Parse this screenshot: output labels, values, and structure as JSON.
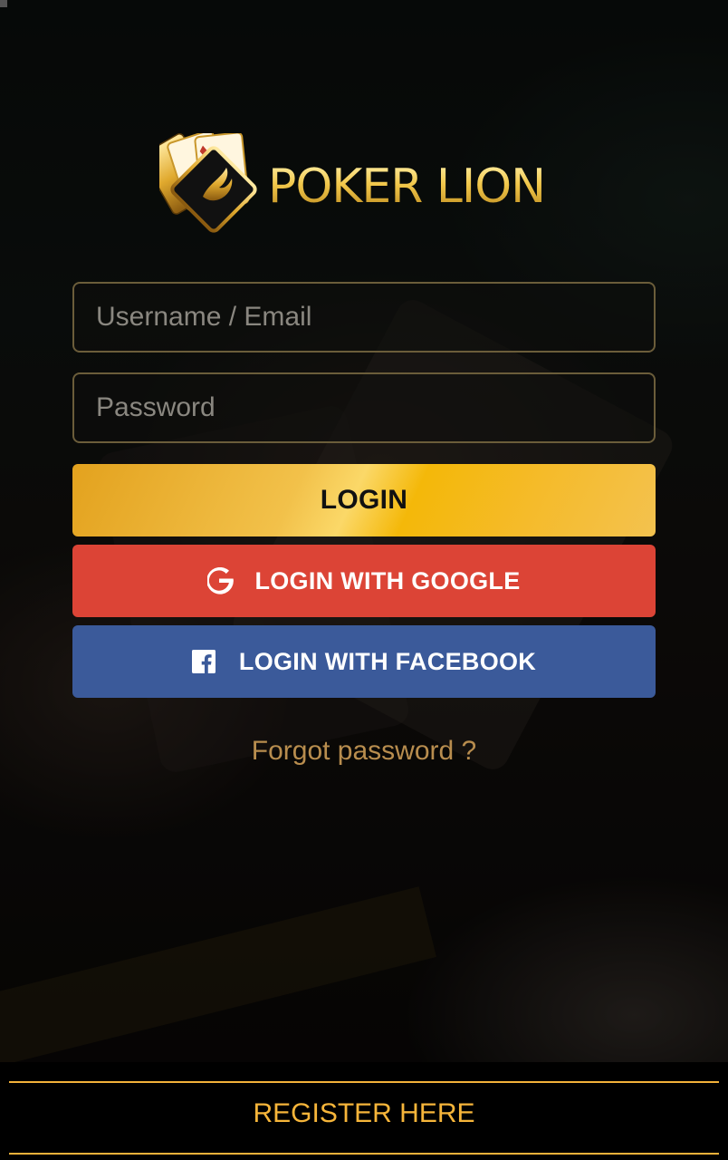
{
  "brand": {
    "name": "POKER LION",
    "accent_gold": "#f3b23a"
  },
  "login_form": {
    "username_placeholder": "Username / Email",
    "password_placeholder": "Password",
    "login_label": "LOGIN",
    "google_label": "LOGIN WITH GOOGLE",
    "facebook_label": "LOGIN WITH FACEBOOK",
    "forgot_label": "Forgot password ?"
  },
  "colors": {
    "google_red": "#dc4436",
    "facebook_blue": "#3b5a9a",
    "login_gold": "#f4b809"
  },
  "icons": {
    "google": "google-g-icon",
    "facebook": "facebook-f-icon"
  },
  "footer": {
    "register_label": "REGISTER HERE"
  }
}
